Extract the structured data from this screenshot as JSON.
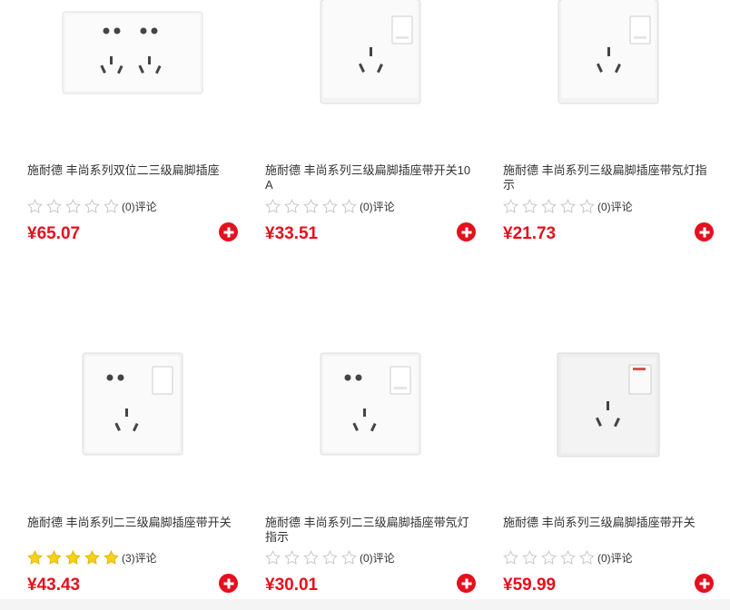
{
  "products": [
    {
      "name": "施耐德 丰尚系列双位二三级扁脚插座",
      "rating": 0,
      "review_label": "(0)评论",
      "price": "¥65.07",
      "image": "double-socket-2-3-pin"
    },
    {
      "name": "施耐德 丰尚系列三级扁脚插座带开关10A",
      "rating": 0,
      "review_label": "(0)评论",
      "price": "¥33.51",
      "image": "3-pin-socket-with-switch"
    },
    {
      "name": "施耐德 丰尚系列三级扁脚插座带氖灯指示",
      "rating": 0,
      "review_label": "(0)评论",
      "price": "¥21.73",
      "image": "3-pin-socket-with-neon-light"
    },
    {
      "name": "施耐德 丰尚系列二三级扁脚插座带开关",
      "rating": 5,
      "review_label": "(3)评论",
      "price": "¥43.43",
      "image": "2-3-pin-socket-with-switch"
    },
    {
      "name": "施耐德 丰尚系列二三级扁脚插座带氖灯指示",
      "rating": 0,
      "review_label": "(0)评论",
      "price": "¥30.01",
      "image": "2-3-pin-socket-with-neon-light"
    },
    {
      "name": "施耐德 丰尚系列三级扁脚插座带开关",
      "rating": 0,
      "review_label": "(0)评论",
      "price": "¥59.99",
      "image": "3-pin-socket-with-red-switch"
    }
  ],
  "colors": {
    "price": "#e4101e",
    "add_button": "#e4101e",
    "star_filled": "#f7d117",
    "star_empty": "#d8d8d8"
  },
  "icons": {
    "add": "plus-circle-icon",
    "star": "star-icon"
  }
}
